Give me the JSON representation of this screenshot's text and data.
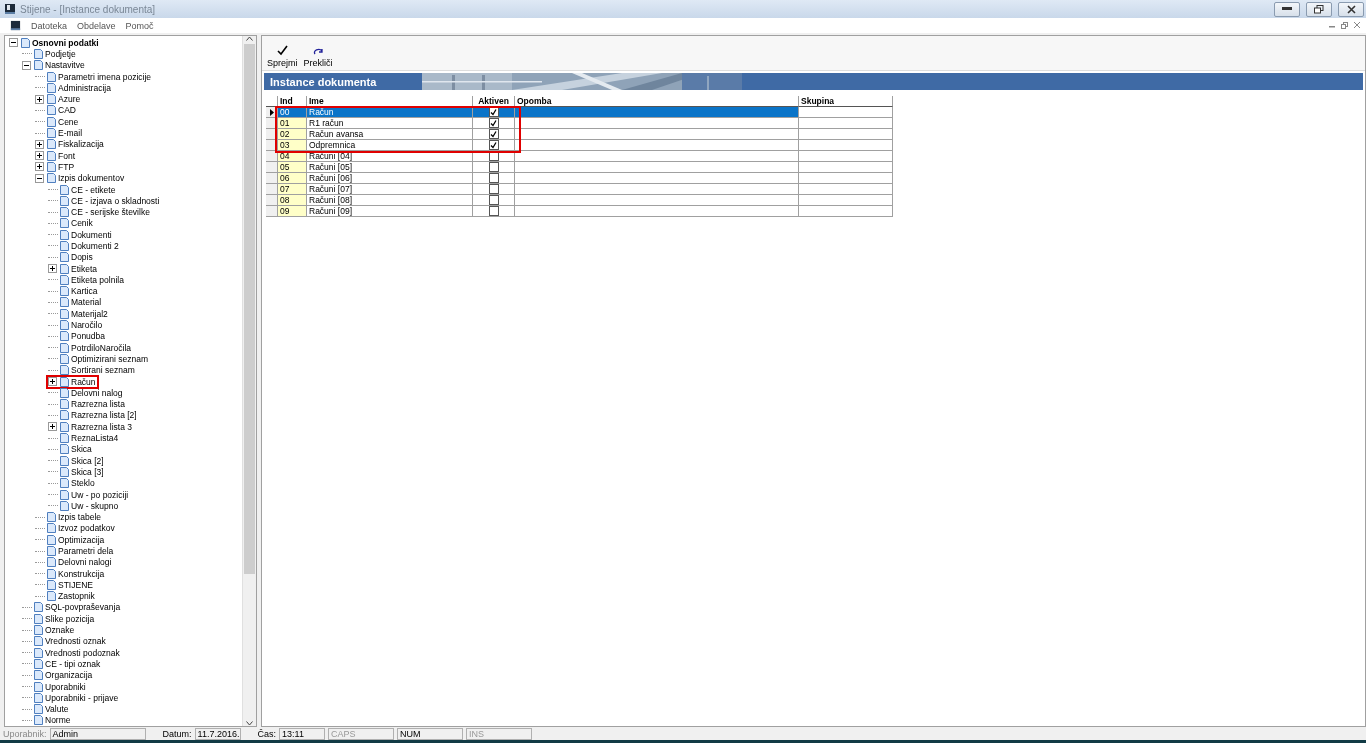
{
  "window": {
    "title": "Stijene - [Instance dokumenta]",
    "active": false
  },
  "menu": [
    "Datoteka",
    "Obdelave",
    "Pomoč"
  ],
  "tree": [
    {
      "label": "Osnovni podatki",
      "bold": true,
      "expanded": true,
      "children": [
        {
          "label": "Podjetje"
        },
        {
          "label": "Nastavitve",
          "expanded": true,
          "children": [
            {
              "label": "Parametri imena pozicije"
            },
            {
              "label": "Administracija"
            },
            {
              "label": "Azure",
              "expanded": false
            },
            {
              "label": "CAD"
            },
            {
              "label": "Cene"
            },
            {
              "label": "E-mail"
            },
            {
              "label": "Fiskalizacija",
              "expanded": false
            },
            {
              "label": "Font",
              "expanded": false
            },
            {
              "label": "FTP",
              "expanded": false
            },
            {
              "label": "Izpis dokumentov",
              "expanded": true,
              "children": [
                {
                  "label": "CE - etikete"
                },
                {
                  "label": "CE - izjava o skladnosti"
                },
                {
                  "label": "CE - serijske številke"
                },
                {
                  "label": "Cenik"
                },
                {
                  "label": "Dokumenti"
                },
                {
                  "label": "Dokumenti 2"
                },
                {
                  "label": "Dopis"
                },
                {
                  "label": "Etiketa",
                  "expanded": false
                },
                {
                  "label": "Etiketa polnila"
                },
                {
                  "label": "Kartica"
                },
                {
                  "label": "Material"
                },
                {
                  "label": "Materijal2"
                },
                {
                  "label": "Naročilo"
                },
                {
                  "label": "Ponudba"
                },
                {
                  "label": "PotrdiloNaročila"
                },
                {
                  "label": "Optimizirani seznam"
                },
                {
                  "label": "Sortirani seznam"
                },
                {
                  "label": "Račun",
                  "expanded": false,
                  "highlighted": true
                },
                {
                  "label": "Delovni nalog"
                },
                {
                  "label": "Razrezna lista"
                },
                {
                  "label": "Razrezna lista [2]"
                },
                {
                  "label": "Razrezna lista 3",
                  "expanded": false
                },
                {
                  "label": "ReznaLista4"
                },
                {
                  "label": "Skica"
                },
                {
                  "label": "Skica [2]"
                },
                {
                  "label": "Skica [3]"
                },
                {
                  "label": "Steklo"
                },
                {
                  "label": "Uw - po poziciji"
                },
                {
                  "label": "Uw - skupno"
                }
              ]
            },
            {
              "label": "Izpis tabele"
            },
            {
              "label": "Izvoz podatkov"
            },
            {
              "label": "Optimizacija"
            },
            {
              "label": "Parametri dela"
            },
            {
              "label": "Delovni nalogi"
            },
            {
              "label": "Konstrukcija"
            },
            {
              "label": "STIJENE"
            },
            {
              "label": "Zastopnik"
            }
          ]
        },
        {
          "label": "SQL-povpraševanja"
        },
        {
          "label": "Slike pozicija"
        },
        {
          "label": "Oznake"
        },
        {
          "label": "Vrednosti oznak"
        },
        {
          "label": "Vrednosti podoznak"
        },
        {
          "label": "CE -  tipi oznak"
        },
        {
          "label": "Organizacija"
        },
        {
          "label": "Uporabniki"
        },
        {
          "label": "Uporabniki - prijave"
        },
        {
          "label": "Valute"
        },
        {
          "label": "Norme"
        }
      ]
    }
  ],
  "toolbar": [
    {
      "kind": "save",
      "label": "Sprejmi"
    },
    {
      "kind": "cancel",
      "label": "Prekliči"
    }
  ],
  "panel_title": "Instance dokumenta",
  "table": {
    "columns": [
      "Ind",
      "Ime",
      "Aktiven",
      "Opomba",
      "Skupina"
    ],
    "rows": [
      {
        "ind": "00",
        "ime": "Račun",
        "checked": true,
        "selected": true,
        "highlighted": true
      },
      {
        "ind": "01",
        "ime": "R1 račun",
        "checked": true,
        "selected": false,
        "highlighted": true
      },
      {
        "ind": "02",
        "ime": "Račun avansa",
        "checked": true,
        "selected": false,
        "highlighted": true
      },
      {
        "ind": "03",
        "ime": "Odpremnica",
        "checked": true,
        "selected": false,
        "highlighted": true
      },
      {
        "ind": "04",
        "ime": "Računi [04]",
        "checked": false,
        "selected": false,
        "highlighted": false
      },
      {
        "ind": "05",
        "ime": "Računi [05]",
        "checked": false,
        "selected": false,
        "highlighted": false
      },
      {
        "ind": "06",
        "ime": "Računi [06]",
        "checked": false,
        "selected": false,
        "highlighted": false
      },
      {
        "ind": "07",
        "ime": "Računi [07]",
        "checked": false,
        "selected": false,
        "highlighted": false
      },
      {
        "ind": "08",
        "ime": "Računi [08]",
        "checked": false,
        "selected": false,
        "highlighted": false
      },
      {
        "ind": "09",
        "ime": "Računi [09]",
        "checked": false,
        "selected": false,
        "highlighted": false
      }
    ]
  },
  "status_bar": [
    {
      "kind": "field",
      "label": "Uporabnik:",
      "value": "Admin",
      "label_disabled": true
    },
    {
      "kind": "field",
      "label": "Datum:",
      "value": "11.7.2016.",
      "label_disabled": false
    },
    {
      "kind": "field",
      "label": "Čas:",
      "value": "13:11",
      "label_disabled": false
    },
    {
      "kind": "indicator",
      "value": "CAPS",
      "on": false
    },
    {
      "kind": "indicator",
      "value": "NUM",
      "on": true
    },
    {
      "kind": "indicator",
      "value": "INS",
      "on": false
    }
  ]
}
